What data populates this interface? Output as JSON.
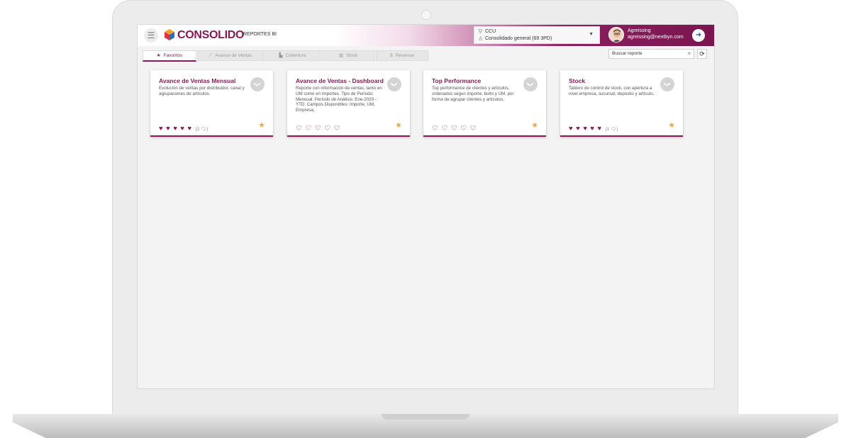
{
  "app": {
    "brand": "CONSOLIDO",
    "subtitle": "REPORTES BI",
    "menu_icon": "hamburger-icon",
    "brand_color": "#8a1a55"
  },
  "context": {
    "company": "CCU",
    "view": "Consolidado general (69 3PD)"
  },
  "user": {
    "name": "Agreissing",
    "email": "agreissing@nextbyn.com"
  },
  "tabs": [
    {
      "label": "Favoritos",
      "icon": "star-icon",
      "active": true
    },
    {
      "label": "Avance de Ventas",
      "icon": "line-chart-icon",
      "active": false
    },
    {
      "label": "Cobertura",
      "icon": "bar-chart-icon",
      "active": false
    },
    {
      "label": "Stock",
      "icon": "warehouse-icon",
      "active": false
    },
    {
      "label": "Revenue",
      "icon": "dollar-icon",
      "active": false
    }
  ],
  "search": {
    "value": "Buscar reporte",
    "clear": "×",
    "refresh": "⟳"
  },
  "cards": [
    {
      "title": "Avance de Ventas Mensual",
      "description": "Evolución de ventas por distribuidor, canal y agrupaciones de artículos.",
      "rating": 5,
      "reviews": "(2 🗨)",
      "favorite": true
    },
    {
      "title": "Avance de Ventas - Dashboard",
      "description": "Reporte con información de ventas, tanto en UM como en Importes. Tipo de Período: Mensual. Período de Análisis: Ene-2020 - YTD. Campos Disponibles: Importe, UM, Empresa,",
      "rating": 0,
      "reviews": "",
      "favorite": true
    },
    {
      "title": "Top Performance",
      "description": "Top performance de clientes y artículos, ordenados segun importe, bulto y UM, por forma de agrupar clientes y artículos.",
      "rating": 0,
      "reviews": "",
      "favorite": true
    },
    {
      "title": "Stock",
      "description": "Tablero de control de stock, con apertura a nivel empresa, sucursal, deposito y artículo.",
      "rating": 5,
      "reviews": "(1 🗨)",
      "favorite": true
    }
  ]
}
